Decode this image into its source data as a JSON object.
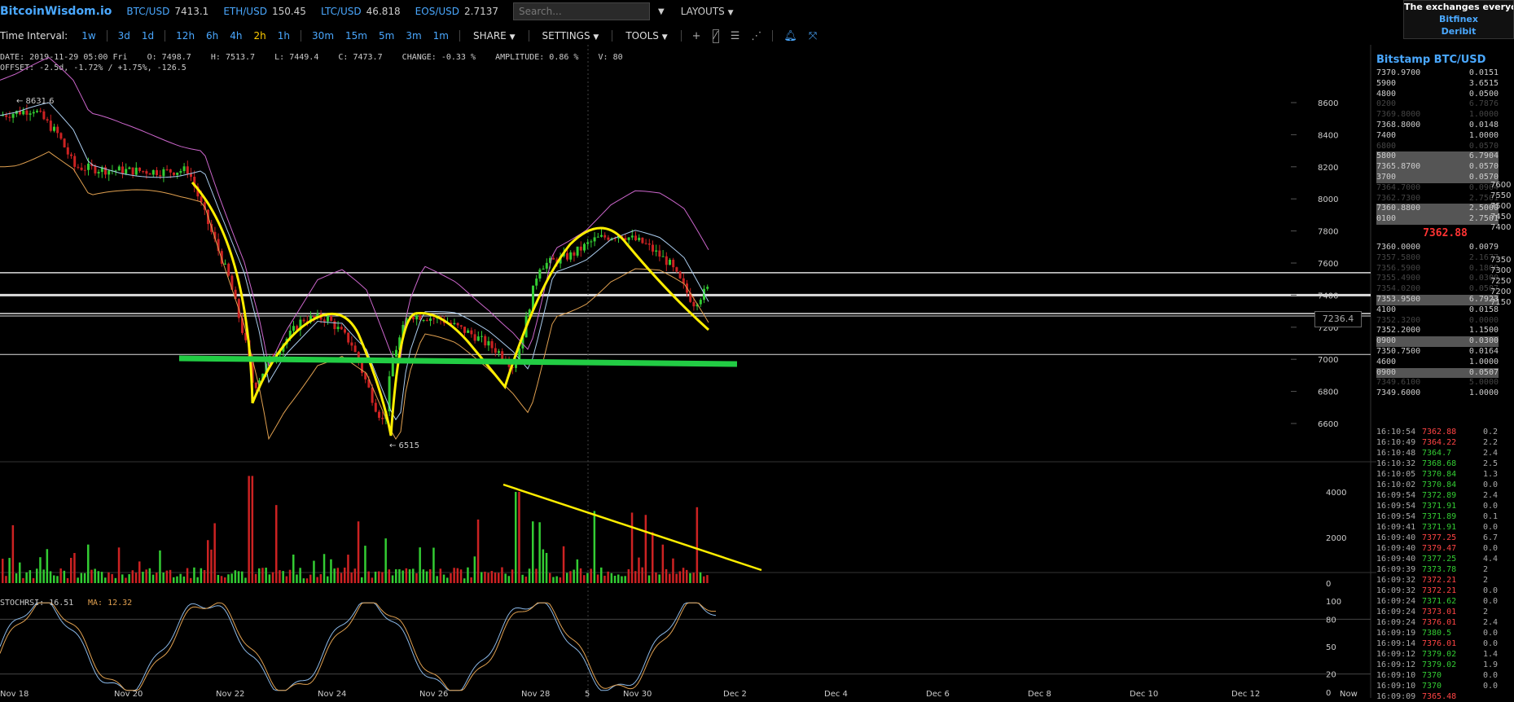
{
  "brand": "BitcoinWisdom.io",
  "tickers": [
    {
      "sym": "BTC/USD",
      "val": "7413.1"
    },
    {
      "sym": "ETH/USD",
      "val": "150.45"
    },
    {
      "sym": "LTC/USD",
      "val": "46.818"
    },
    {
      "sym": "EOS/USD",
      "val": "2.7137"
    }
  ],
  "search": {
    "placeholder": "Search..."
  },
  "layouts_label": "LAYOUTS",
  "notice": {
    "text": "The exchanges everyone",
    "links": [
      "Bitfinex",
      "Deribit"
    ]
  },
  "toolbar": {
    "label": "Time Interval:",
    "intervals": [
      "1w",
      "3d",
      "1d",
      "12h",
      "6h",
      "4h",
      "2h",
      "1h",
      "30m",
      "15m",
      "5m",
      "3m",
      "1m"
    ],
    "active_interval": "2h",
    "menus": [
      "SHARE",
      "SETTINGS",
      "TOOLS"
    ],
    "tools": [
      "plus-icon",
      "line-tool-icon",
      "hlines-icon",
      "fib-icon",
      "bell-icon",
      "fullscreen-icon"
    ]
  },
  "info": {
    "line1": "DATE: 2019-11-29 05:00 Fri    O: 7498.7    H: 7513.7    L: 7449.4    C: 7473.7    CHANGE: -0.33 %    AMPLITUDE: 0.86 %    V: 80",
    "line2": "OFFSET: -2.5d, -1.72% / +1.75%, -126.5"
  },
  "chart": {
    "price_labels": [
      "8600",
      "8400",
      "8200",
      "8000",
      "7800",
      "7600",
      "7400",
      "7200",
      "7000",
      "6800",
      "6600"
    ],
    "high_marker": "← 8631.6",
    "low_marker": "← 6515",
    "current_tag": "7236.4",
    "volume_labels": [
      "4000",
      "2000",
      "0"
    ],
    "rsi_labels": [
      "100",
      "80",
      "50",
      "20",
      "0"
    ],
    "rsi_text": "STOCHRSI: 16.51",
    "ma_text": "MA: 12.32",
    "dates": [
      "Nov 18",
      "Nov 20",
      "Nov 22",
      "Nov 24",
      "Nov 26",
      "Nov 28",
      "Nov 30",
      "Dec 2",
      "Dec 4",
      "Dec 6",
      "Dec 8",
      "Dec 10",
      "Dec 12",
      "Now"
    ],
    "cursor_date": "5",
    "colors": {
      "up": "#33cc33",
      "down": "#cc2222",
      "yellow": "#ffee00",
      "green_band": "#22cc44",
      "upper_band": "#cc66cc",
      "lower_band": "#e0a050",
      "ma": "#aaccee"
    }
  },
  "orderbook": {
    "title": "Bitstamp BTC/USD",
    "asks": [
      {
        "p": "7370.9700",
        "a": "0.0151",
        "s": ""
      },
      {
        "p": "5900",
        "a": "3.6515",
        "s": ""
      },
      {
        "p": "4800",
        "a": "0.0500",
        "s": ""
      },
      {
        "p": "0200",
        "a": "6.7876",
        "s": "dim"
      },
      {
        "p": "7369.8000",
        "a": "1.0000",
        "s": "dim"
      },
      {
        "p": "7368.8000",
        "a": "0.0148",
        "s": ""
      },
      {
        "p": "7400",
        "a": "1.0000",
        "s": ""
      },
      {
        "p": "6800",
        "a": "0.0570",
        "s": "dim"
      },
      {
        "p": "5800",
        "a": "6.7904",
        "s": "hl"
      },
      {
        "p": "7365.8700",
        "a": "0.0570",
        "s": "hl"
      },
      {
        "p": "3700",
        "a": "0.0570",
        "s": "hl"
      },
      {
        "p": "7364.7000",
        "a": "0.0904",
        "s": "dim"
      },
      {
        "p": "7362.7300",
        "a": "2.7501",
        "s": "dim"
      },
      {
        "p": "7360.8800",
        "a": "2.5000",
        "s": "hl"
      },
      {
        "p": "0100",
        "a": "2.7501",
        "s": "hl"
      }
    ],
    "mid": "7362.88",
    "bids": [
      {
        "p": "7360.0000",
        "a": "0.0079",
        "s": ""
      },
      {
        "p": "7357.5800",
        "a": "2.1677",
        "s": "dim"
      },
      {
        "p": "7356.5900",
        "a": "0.1800",
        "s": "dim"
      },
      {
        "p": "7355.4900",
        "a": "0.0300",
        "s": "dim"
      },
      {
        "p": "7354.0200",
        "a": "0.0507",
        "s": "dim"
      },
      {
        "p": "7353.9500",
        "a": "6.7923",
        "s": "hl"
      },
      {
        "p": "4100",
        "a": "0.0158",
        "s": ""
      },
      {
        "p": "7352.3200",
        "a": "0.0000",
        "s": "dim"
      },
      {
        "p": "7352.2000",
        "a": "1.1500",
        "s": ""
      },
      {
        "p": "0900",
        "a": "0.0300",
        "s": "hl"
      },
      {
        "p": "7350.7500",
        "a": "0.0164",
        "s": ""
      },
      {
        "p": "4600",
        "a": "1.0000",
        "s": ""
      },
      {
        "p": "0900",
        "a": "0.0507",
        "s": "hl"
      },
      {
        "p": "7349.6100",
        "a": "5.0000",
        "s": "dim"
      },
      {
        "p": "7349.6000",
        "a": "1.0000",
        "s": ""
      }
    ],
    "depth_top": [
      "7600",
      "7550",
      "7500",
      "7450",
      "7400"
    ],
    "depth_bottom": [
      "7350",
      "7300",
      "7250",
      "7200",
      "7150"
    ]
  },
  "trades": [
    {
      "t": "16:10:54",
      "p": "7362.88",
      "a": "0.2",
      "d": "dn"
    },
    {
      "t": "16:10:49",
      "p": "7364.22",
      "a": "2.2",
      "d": "dn"
    },
    {
      "t": "16:10:48",
      "p": "7364.7",
      "a": "2.4",
      "d": "up"
    },
    {
      "t": "16:10:32",
      "p": "7368.68",
      "a": "2.5",
      "d": "up"
    },
    {
      "t": "16:10:05",
      "p": "7370.84",
      "a": "1.3",
      "d": "up"
    },
    {
      "t": "16:10:02",
      "p": "7370.84",
      "a": "0.0",
      "d": "up"
    },
    {
      "t": "16:09:54",
      "p": "7372.89",
      "a": "2.4",
      "d": "up"
    },
    {
      "t": "16:09:54",
      "p": "7371.91",
      "a": "0.0",
      "d": "up"
    },
    {
      "t": "16:09:54",
      "p": "7371.89",
      "a": "0.1",
      "d": "up"
    },
    {
      "t": "16:09:41",
      "p": "7371.91",
      "a": "0.0",
      "d": "up"
    },
    {
      "t": "16:09:40",
      "p": "7377.25",
      "a": "6.7",
      "d": "dn"
    },
    {
      "t": "16:09:40",
      "p": "7379.47",
      "a": "0.0",
      "d": "dn"
    },
    {
      "t": "16:09:40",
      "p": "7377.25",
      "a": "4.4",
      "d": "up"
    },
    {
      "t": "16:09:39",
      "p": "7373.78",
      "a": "2",
      "d": "up"
    },
    {
      "t": "16:09:32",
      "p": "7372.21",
      "a": "2",
      "d": "dn"
    },
    {
      "t": "16:09:32",
      "p": "7372.21",
      "a": "0.0",
      "d": "dn"
    },
    {
      "t": "16:09:24",
      "p": "7371.62",
      "a": "0.0",
      "d": "up"
    },
    {
      "t": "16:09:24",
      "p": "7373.01",
      "a": "2",
      "d": "dn"
    },
    {
      "t": "16:09:24",
      "p": "7376.01",
      "a": "2.4",
      "d": "dn"
    },
    {
      "t": "16:09:19",
      "p": "7380.5",
      "a": "0.0",
      "d": "up"
    },
    {
      "t": "16:09:14",
      "p": "7376.01",
      "a": "0.0",
      "d": "dn"
    },
    {
      "t": "16:09:12",
      "p": "7379.02",
      "a": "1.4",
      "d": "up"
    },
    {
      "t": "16:09:12",
      "p": "7379.02",
      "a": "1.9",
      "d": "up"
    },
    {
      "t": "16:09:10",
      "p": "7370",
      "a": "0.0",
      "d": "up"
    },
    {
      "t": "16:09:10",
      "p": "7370",
      "a": "0.0",
      "d": "up"
    },
    {
      "t": "16:09:09",
      "p": "7365.48",
      "a": "",
      "d": "dn"
    }
  ]
}
